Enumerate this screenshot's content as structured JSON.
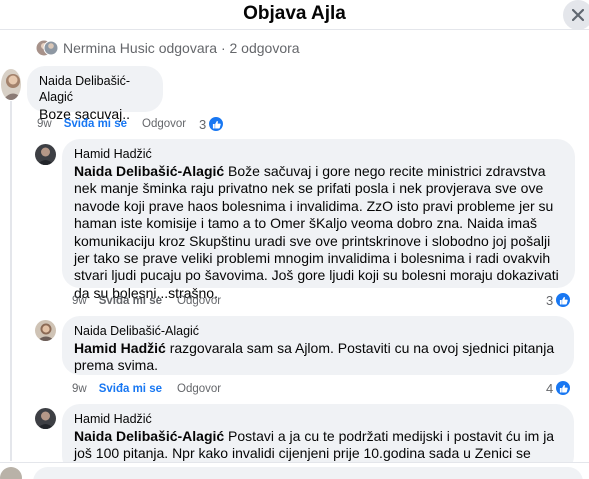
{
  "header": {
    "title": "Objava Ajla"
  },
  "replies_summary": {
    "text": "Nermina Husic odgovara · 2 odgovora"
  },
  "comments": [
    {
      "author": "Naida Delibašić-Alagić",
      "mention": "",
      "text": "Boze sacuvaj..",
      "time": "9w",
      "like_label": "Sviđa mi se",
      "reply_label": "Odgovor",
      "reaction_count": "3"
    },
    {
      "author": "Hamid Hadžić",
      "mention": "Naida Delibašić-Alagić",
      "text": " Bože sačuvaj i gore nego recite ministrici zdravstva nek manje šminka raju privatno nek se prifati posla i nek provjerava sve ove navode koji prave haos bolesnima i invalidima. ZzO isto pravi probleme jer su haman iste komisije i tamo a to Omer šKaljo veoma dobro zna. Naida imaš komunikaciju kroz Skupštinu uradi sve ove printskrinove i slobodno joj pošalji jer tako se prave veliki problemi mnogim invalidima i bolesnima i radi ovakvih stvari ljudi pucaju po šavovima. Još gore ljudi koji su bolesni moraju dokazivati da su bolesni...strašno.",
      "time": "9w",
      "like_label": "Sviđa mi se",
      "reply_label": "Odgovor",
      "reaction_count": "3"
    },
    {
      "author": "Naida Delibašić-Alagić",
      "mention": "Hamid Hadžić",
      "text": " razgovarala sam sa Ajlom. Postaviti cu na ovoj sjednici pitanja prema svima.",
      "time": "9w",
      "like_label": "Sviđa mi se",
      "reply_label": "Odgovor",
      "reaction_count": "4"
    },
    {
      "author": "Hamid Hadžić",
      "mention": "Naida Delibašić-Alagić",
      "text": " Postavi a ja cu te podržati medijski i postavit ću im ja još 100 pitanja. Npr kako invalidi cijenjeni prije 10.godina sada u Zenici se cijene da",
      "time": "",
      "like_label": "",
      "reply_label": "",
      "reaction_count": ""
    }
  ],
  "colors": {
    "bubble": "#f0f2f5",
    "accent": "#1877f2",
    "secondary_text": "#65676b"
  }
}
